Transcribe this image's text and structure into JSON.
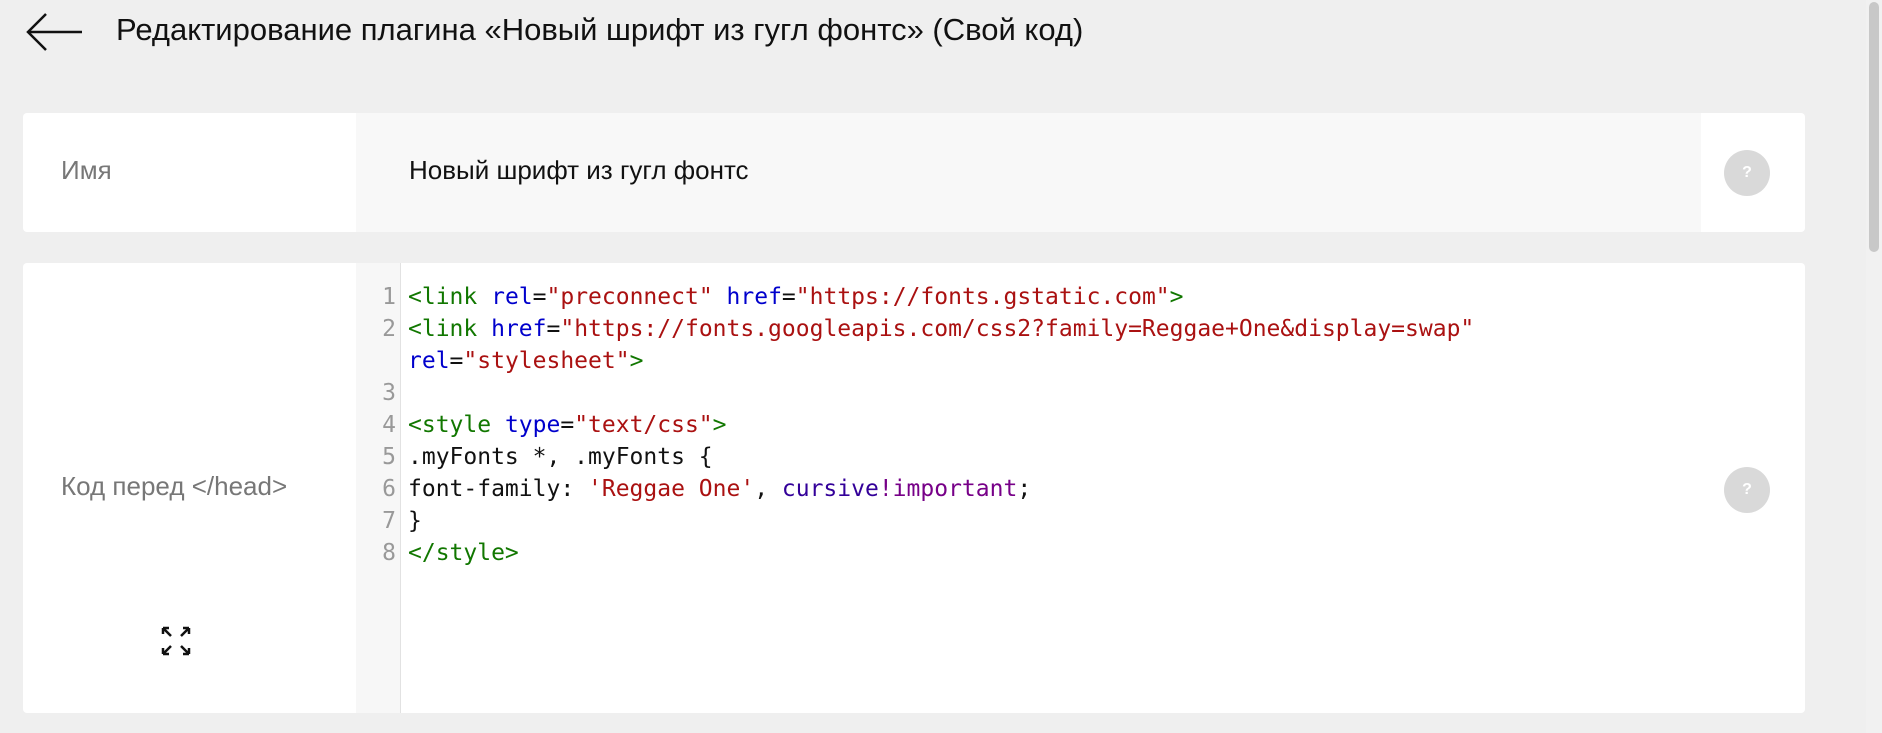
{
  "header": {
    "back_icon": "arrow-left-icon",
    "title": "Редактирование плагина «Новый шрифт из гугл фонтс» (Свой код)"
  },
  "name_card": {
    "label": "Имя",
    "value": "Новый шрифт из гугл фонтс",
    "help_label": "?"
  },
  "code_card": {
    "label": "Код перед </head>",
    "help_label": "?",
    "expand_icon": "expand-icon",
    "lines": [
      {
        "number": "1",
        "tokens": [
          {
            "text": "<link ",
            "cls": "t-tag"
          },
          {
            "text": "rel",
            "cls": "t-attr"
          },
          {
            "text": "=",
            "cls": "t-plain"
          },
          {
            "text": "\"preconnect\"",
            "cls": "t-str"
          },
          {
            "text": " ",
            "cls": "t-plain"
          },
          {
            "text": "href",
            "cls": "t-attr"
          },
          {
            "text": "=",
            "cls": "t-plain"
          },
          {
            "text": "\"https://fonts.gstatic.com\"",
            "cls": "t-str"
          },
          {
            "text": ">",
            "cls": "t-tag"
          }
        ]
      },
      {
        "number": "2",
        "tokens": [
          {
            "text": "<link ",
            "cls": "t-tag"
          },
          {
            "text": "href",
            "cls": "t-attr"
          },
          {
            "text": "=",
            "cls": "t-plain"
          },
          {
            "text": "\"https://fonts.googleapis.com/css2?family=Reggae+One&display=swap\"",
            "cls": "t-str"
          }
        ]
      },
      {
        "number": "",
        "tokens": [
          {
            "text": "rel",
            "cls": "t-attr"
          },
          {
            "text": "=",
            "cls": "t-plain"
          },
          {
            "text": "\"stylesheet\"",
            "cls": "t-str"
          },
          {
            "text": ">",
            "cls": "t-tag"
          }
        ]
      },
      {
        "number": "3",
        "tokens": []
      },
      {
        "number": "4",
        "tokens": [
          {
            "text": "<style ",
            "cls": "t-tag"
          },
          {
            "text": "type",
            "cls": "t-attr"
          },
          {
            "text": "=",
            "cls": "t-plain"
          },
          {
            "text": "\"text/css\"",
            "cls": "t-str"
          },
          {
            "text": ">",
            "cls": "t-tag"
          }
        ]
      },
      {
        "number": "5",
        "tokens": [
          {
            "text": ".myFonts *, .myFonts {",
            "cls": "t-plain"
          }
        ]
      },
      {
        "number": "6",
        "tokens": [
          {
            "text": "font-family: ",
            "cls": "t-plain"
          },
          {
            "text": "'Reggae One'",
            "cls": "t-str"
          },
          {
            "text": ", ",
            "cls": "t-plain"
          },
          {
            "text": "cursive",
            "cls": "t-kw"
          },
          {
            "text": "!important",
            "cls": "t-imp"
          },
          {
            "text": ";",
            "cls": "t-plain"
          }
        ]
      },
      {
        "number": "7",
        "tokens": [
          {
            "text": "}",
            "cls": "t-plain"
          }
        ]
      },
      {
        "number": "8",
        "tokens": [
          {
            "text": "</style>",
            "cls": "t-tag"
          }
        ]
      }
    ]
  }
}
